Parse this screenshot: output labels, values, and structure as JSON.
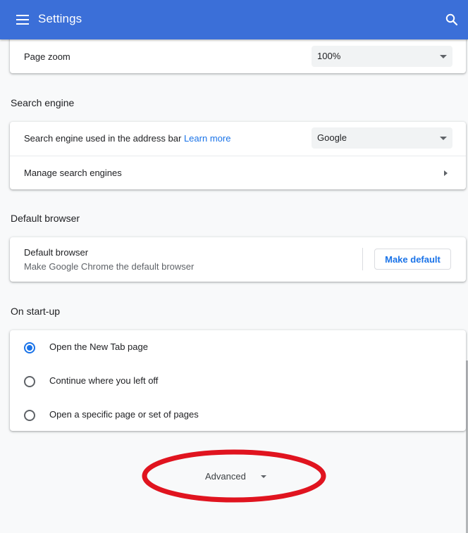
{
  "header": {
    "title": "Settings",
    "menu_icon": "hamburger-menu-icon",
    "search_icon": "search-icon",
    "bar_color": "#3b6fd8"
  },
  "appearance": {
    "page_zoom": {
      "label": "Page zoom",
      "value": "100%"
    }
  },
  "search_engine": {
    "section_title": "Search engine",
    "address_bar_label": "Search engine used in the address bar",
    "learn_more": "Learn more",
    "selected_engine": "Google",
    "manage_label": "Manage search engines"
  },
  "default_browser": {
    "section_title": "Default browser",
    "title": "Default browser",
    "description": "Make Google Chrome the default browser",
    "button_label": "Make default"
  },
  "startup": {
    "section_title": "On start-up",
    "options": [
      {
        "label": "Open the New Tab page",
        "checked": true
      },
      {
        "label": "Continue where you left off",
        "checked": false
      },
      {
        "label": "Open a specific page or set of pages",
        "checked": false
      }
    ]
  },
  "advanced": {
    "label": "Advanced",
    "highlight_color": "#e0141f"
  },
  "colors": {
    "accent": "#1a73e8",
    "page_bg": "#f8f9fa"
  }
}
